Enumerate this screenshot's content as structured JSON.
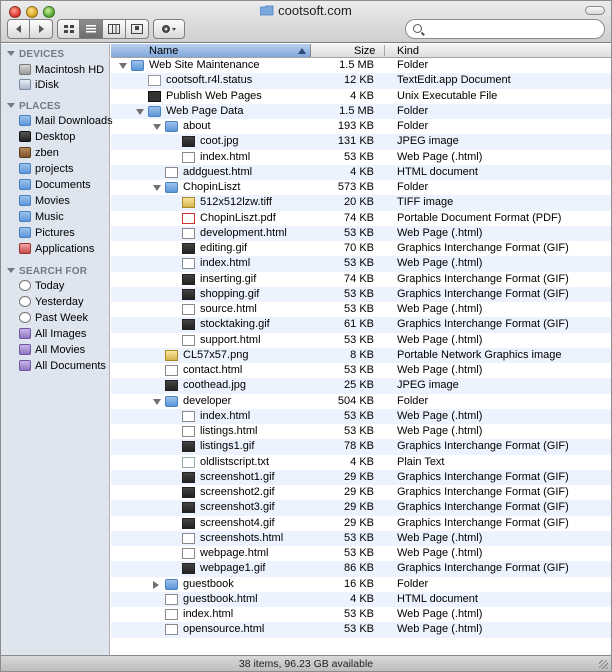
{
  "window": {
    "title": "cootsoft.com",
    "status": "38 items, 96.23 GB available"
  },
  "toolbar": {
    "back_icon": "chevron-left-icon",
    "forward_icon": "chevron-right-icon",
    "views": [
      "icon-view",
      "list-view",
      "column-view",
      "coverflow-view"
    ],
    "active_view": "list-view",
    "action_icon": "gear-icon",
    "search_placeholder": ""
  },
  "sidebar": {
    "devices_header": "DEVICES",
    "devices": [
      {
        "label": "Macintosh HD",
        "icon": "hard-drive-icon"
      },
      {
        "label": "iDisk",
        "icon": "idisk-icon"
      }
    ],
    "places_header": "PLACES",
    "places": [
      {
        "label": "Mail Downloads",
        "icon": "folder-icon"
      },
      {
        "label": "Desktop",
        "icon": "desktop-icon"
      },
      {
        "label": "zben",
        "icon": "home-icon"
      },
      {
        "label": "projects",
        "icon": "folder-icon"
      },
      {
        "label": "Documents",
        "icon": "documents-icon"
      },
      {
        "label": "Movies",
        "icon": "movies-icon"
      },
      {
        "label": "Music",
        "icon": "music-icon"
      },
      {
        "label": "Pictures",
        "icon": "pictures-icon"
      },
      {
        "label": "Applications",
        "icon": "applications-icon"
      }
    ],
    "search_header": "SEARCH FOR",
    "searches": [
      {
        "label": "Today",
        "icon": "clock-icon"
      },
      {
        "label": "Yesterday",
        "icon": "clock-icon"
      },
      {
        "label": "Past Week",
        "icon": "clock-icon"
      },
      {
        "label": "All Images",
        "icon": "smart-folder-icon"
      },
      {
        "label": "All Movies",
        "icon": "smart-folder-icon"
      },
      {
        "label": "All Documents",
        "icon": "smart-folder-icon"
      }
    ]
  },
  "columns": {
    "name": "Name",
    "size": "Size",
    "kind": "Kind"
  },
  "rows": [
    {
      "name": "Web Site Maintenance",
      "size": "1.5 MB",
      "kind": "Folder",
      "level": 0,
      "type": "folder",
      "disclosure": "open"
    },
    {
      "name": "cootsoft.r4l.status",
      "size": "12 KB",
      "kind": "TextEdit.app Document",
      "level": 1,
      "type": "doc"
    },
    {
      "name": "Publish Web Pages",
      "size": "4 KB",
      "kind": "Unix Executable File",
      "level": 1,
      "type": "exec"
    },
    {
      "name": "Web Page Data",
      "size": "1.5 MB",
      "kind": "Folder",
      "level": 1,
      "type": "folder",
      "disclosure": "open"
    },
    {
      "name": "about",
      "size": "193 KB",
      "kind": "Folder",
      "level": 2,
      "type": "folder",
      "disclosure": "open"
    },
    {
      "name": "coot.jpg",
      "size": "131 KB",
      "kind": "JPEG image",
      "level": 3,
      "type": "gif"
    },
    {
      "name": "index.html",
      "size": "53 KB",
      "kind": "Web Page (.html)",
      "level": 3,
      "type": "html"
    },
    {
      "name": "addguest.html",
      "size": "4 KB",
      "kind": "HTML document",
      "level": 2,
      "type": "html"
    },
    {
      "name": "ChopinLiszt",
      "size": "573 KB",
      "kind": "Folder",
      "level": 2,
      "type": "folder",
      "disclosure": "open"
    },
    {
      "name": "512x512lzw.tiff",
      "size": "20 KB",
      "kind": "TIFF image",
      "level": 3,
      "type": "img"
    },
    {
      "name": "ChopinLiszt.pdf",
      "size": "74 KB",
      "kind": "Portable Document Format (PDF)",
      "level": 3,
      "type": "pdf"
    },
    {
      "name": "development.html",
      "size": "53 KB",
      "kind": "Web Page (.html)",
      "level": 3,
      "type": "html"
    },
    {
      "name": "editing.gif",
      "size": "70 KB",
      "kind": "Graphics Interchange Format (GIF)",
      "level": 3,
      "type": "gif"
    },
    {
      "name": "index.html",
      "size": "53 KB",
      "kind": "Web Page (.html)",
      "level": 3,
      "type": "html"
    },
    {
      "name": "inserting.gif",
      "size": "74 KB",
      "kind": "Graphics Interchange Format (GIF)",
      "level": 3,
      "type": "gif"
    },
    {
      "name": "shopping.gif",
      "size": "53 KB",
      "kind": "Graphics Interchange Format (GIF)",
      "level": 3,
      "type": "gif"
    },
    {
      "name": "source.html",
      "size": "53 KB",
      "kind": "Web Page (.html)",
      "level": 3,
      "type": "html"
    },
    {
      "name": "stocktaking.gif",
      "size": "61 KB",
      "kind": "Graphics Interchange Format (GIF)",
      "level": 3,
      "type": "gif"
    },
    {
      "name": "support.html",
      "size": "53 KB",
      "kind": "Web Page (.html)",
      "level": 3,
      "type": "html"
    },
    {
      "name": "CL57x57.png",
      "size": "8 KB",
      "kind": "Portable Network Graphics image",
      "level": 2,
      "type": "img"
    },
    {
      "name": "contact.html",
      "size": "53 KB",
      "kind": "Web Page (.html)",
      "level": 2,
      "type": "html"
    },
    {
      "name": "coothead.jpg",
      "size": "25 KB",
      "kind": "JPEG image",
      "level": 2,
      "type": "gif"
    },
    {
      "name": "developer",
      "size": "504 KB",
      "kind": "Folder",
      "level": 2,
      "type": "folder",
      "disclosure": "open"
    },
    {
      "name": "index.html",
      "size": "53 KB",
      "kind": "Web Page (.html)",
      "level": 3,
      "type": "html"
    },
    {
      "name": "listings.html",
      "size": "53 KB",
      "kind": "Web Page (.html)",
      "level": 3,
      "type": "html"
    },
    {
      "name": "listings1.gif",
      "size": "78 KB",
      "kind": "Graphics Interchange Format (GIF)",
      "level": 3,
      "type": "gif"
    },
    {
      "name": "oldlistscript.txt",
      "size": "4 KB",
      "kind": "Plain Text",
      "level": 3,
      "type": "txt"
    },
    {
      "name": "screenshot1.gif",
      "size": "29 KB",
      "kind": "Graphics Interchange Format (GIF)",
      "level": 3,
      "type": "gif"
    },
    {
      "name": "screenshot2.gif",
      "size": "29 KB",
      "kind": "Graphics Interchange Format (GIF)",
      "level": 3,
      "type": "gif"
    },
    {
      "name": "screenshot3.gif",
      "size": "29 KB",
      "kind": "Graphics Interchange Format (GIF)",
      "level": 3,
      "type": "gif"
    },
    {
      "name": "screenshot4.gif",
      "size": "29 KB",
      "kind": "Graphics Interchange Format (GIF)",
      "level": 3,
      "type": "gif"
    },
    {
      "name": "screenshots.html",
      "size": "53 KB",
      "kind": "Web Page (.html)",
      "level": 3,
      "type": "html"
    },
    {
      "name": "webpage.html",
      "size": "53 KB",
      "kind": "Web Page (.html)",
      "level": 3,
      "type": "html"
    },
    {
      "name": "webpage1.gif",
      "size": "86 KB",
      "kind": "Graphics Interchange Format (GIF)",
      "level": 3,
      "type": "gif"
    },
    {
      "name": "guestbook",
      "size": "16 KB",
      "kind": "Folder",
      "level": 2,
      "type": "folder",
      "disclosure": "closed"
    },
    {
      "name": "guestbook.html",
      "size": "4 KB",
      "kind": "HTML document",
      "level": 2,
      "type": "html"
    },
    {
      "name": "index.html",
      "size": "53 KB",
      "kind": "Web Page (.html)",
      "level": 2,
      "type": "html"
    },
    {
      "name": "opensource.html",
      "size": "53 KB",
      "kind": "Web Page (.html)",
      "level": 2,
      "type": "html"
    }
  ]
}
